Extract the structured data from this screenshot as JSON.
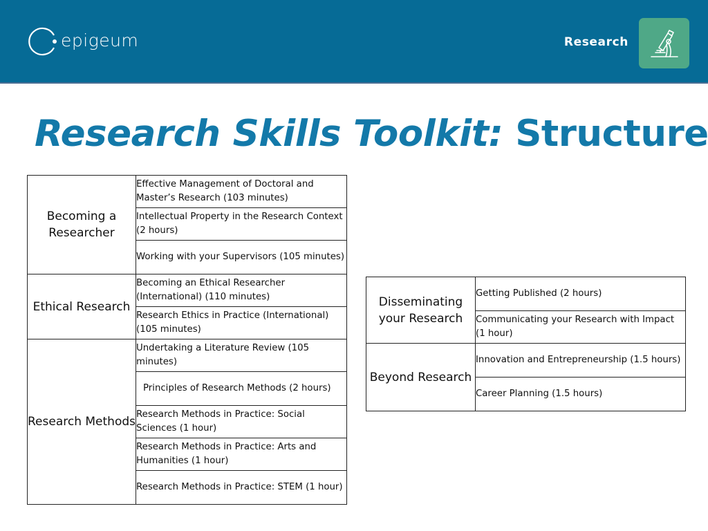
{
  "header": {
    "brand": "epigeum",
    "section": "Research",
    "section_icon": "microscope-icon",
    "colors": {
      "header_bg": "#066b96",
      "badge_bg": "#4fa887",
      "title": "#1379a9"
    }
  },
  "title": {
    "italic_part": "Research Skills Toolkit:",
    "regular_part": "Structure"
  },
  "left_table": {
    "groups": [
      {
        "category": "Becoming a Researcher",
        "modules": [
          "Effective Management of Doctoral and Master’s Research (103 minutes)",
          "Intellectual Property in the Research Context (2 hours)",
          "Working with your Supervisors (105 minutes)"
        ]
      },
      {
        "category": "Ethical Research",
        "modules": [
          "Becoming an Ethical Researcher (International) (110 minutes)",
          "Research Ethics in Practice (International) (105 minutes)"
        ]
      },
      {
        "category": "Research Methods",
        "modules": [
          "Undertaking a Literature Review (105 minutes)",
          "Principles of Research Methods (2 hours)",
          "Research Methods in Practice: Social Sciences (1 hour)",
          "Research Methods in Practice: Arts and Humanities (1 hour)",
          "Research Methods in Practice: STEM (1 hour)"
        ]
      }
    ]
  },
  "right_table": {
    "groups": [
      {
        "category": "Disseminating your Research",
        "modules": [
          "Getting Published (2 hours)",
          "Communicating your Research with Impact (1 hour)"
        ]
      },
      {
        "category": "Beyond Research",
        "modules": [
          "Innovation and Entrepreneurship (1.5 hours)",
          "Career Planning (1.5 hours)"
        ]
      }
    ]
  }
}
